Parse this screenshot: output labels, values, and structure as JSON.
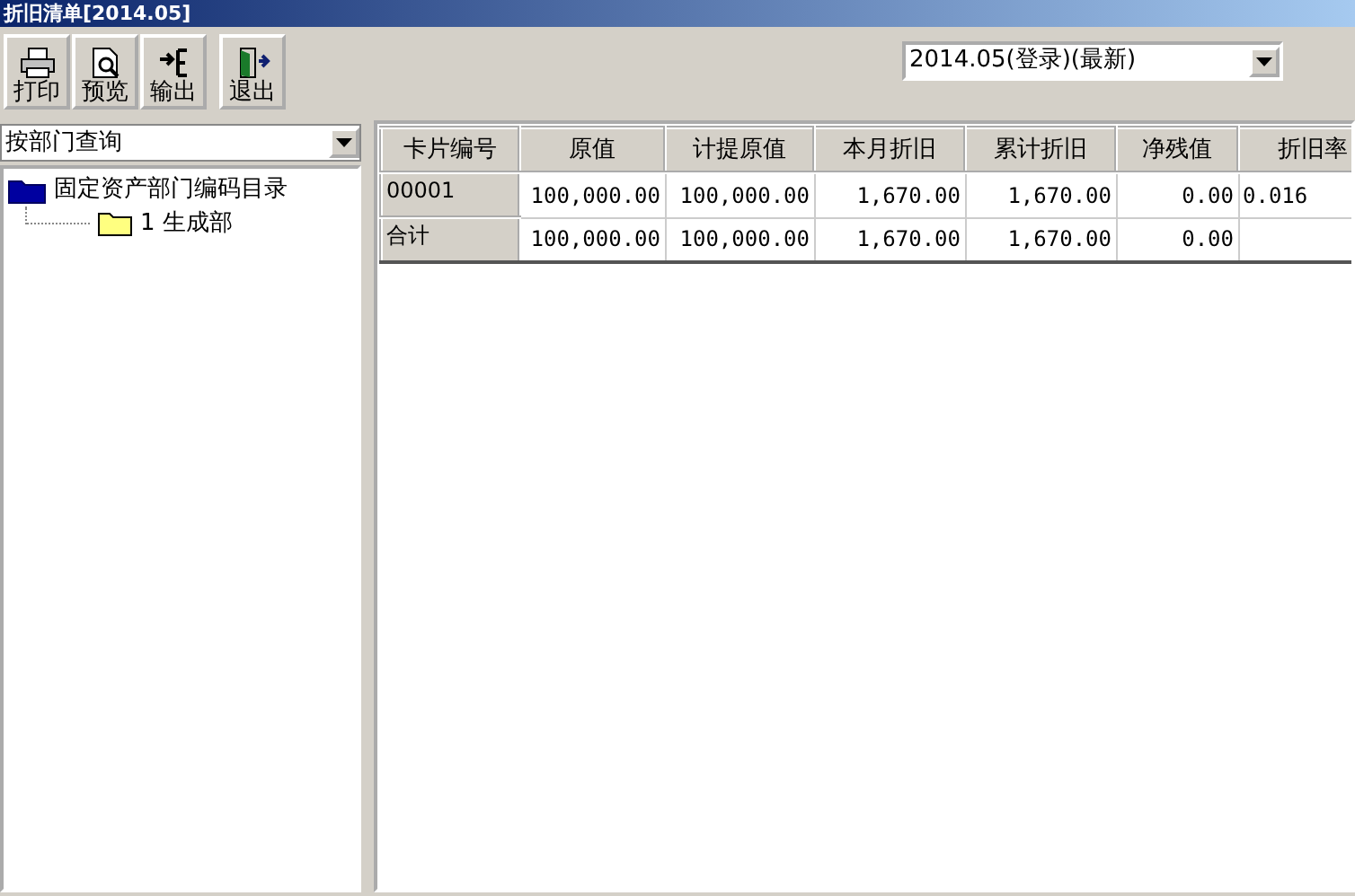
{
  "window": {
    "title": "折旧清单[2014.05]"
  },
  "toolbar": [
    {
      "label": "打印",
      "kind": "print"
    },
    {
      "label": "预览",
      "kind": "preview"
    },
    {
      "label": "输出",
      "kind": "export"
    },
    {
      "label": "退出",
      "kind": "exit"
    }
  ],
  "period_select": {
    "value": "2014.05(登录)(最新)"
  },
  "query_select": {
    "value": "按部门查询"
  },
  "tree": [
    {
      "label": "固定资产部门编码目录",
      "children": [
        {
          "label": "1 生成部"
        }
      ]
    }
  ],
  "table": {
    "columns": [
      "卡片编号",
      "原值",
      "计提原值",
      "本月折旧",
      "累计折旧",
      "净残值",
      "折旧率"
    ],
    "rows": [
      [
        "00001",
        "100,000.00",
        "100,000.00",
        "1,670.00",
        "1,670.00",
        "0.00",
        "0.016"
      ],
      [
        "合计",
        "100,000.00",
        "100,000.00",
        "1,670.00",
        "1,670.00",
        "0.00"
      ]
    ]
  }
}
